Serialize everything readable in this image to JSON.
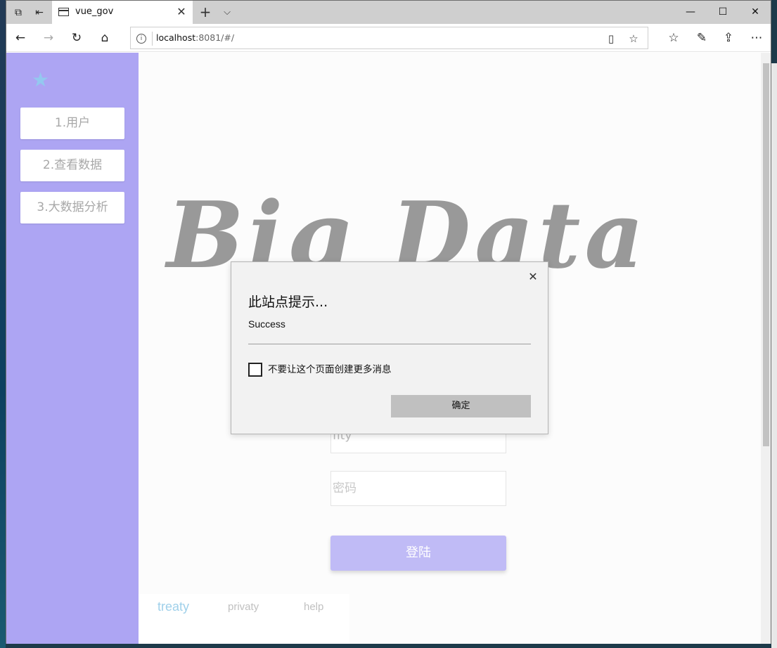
{
  "browser": {
    "tab_title": "vue_gov",
    "address_host": "localhost",
    "address_rest": ":8081/#/"
  },
  "sidebar": {
    "items": [
      {
        "label": "1.用户"
      },
      {
        "label": "2.查看数据"
      },
      {
        "label": "3.大数据分析"
      }
    ]
  },
  "main": {
    "title": "Big Data",
    "username_value": "fity",
    "password_placeholder": "密码",
    "login_label": "登陆",
    "footer": [
      "treaty",
      "privaty",
      "help"
    ]
  },
  "dialog": {
    "title": "此站点提示...",
    "message": "Success",
    "checkbox_label": "不要让这个页面创建更多消息",
    "ok_label": "确定"
  },
  "colors": {
    "sidebar_bg": "#ada5f3",
    "login_button": "#c0bbf6",
    "star": "#94c8ef",
    "footer_active": "#9fd0ea"
  }
}
